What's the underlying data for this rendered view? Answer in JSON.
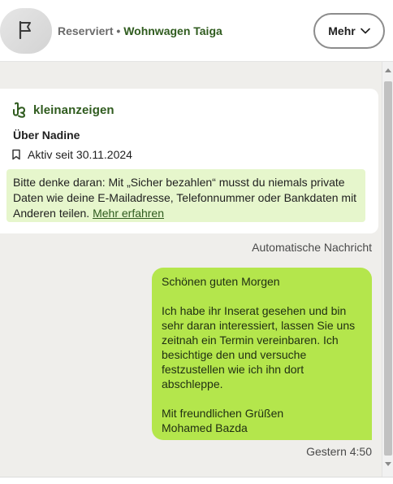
{
  "header": {
    "status": "Reserviert",
    "separator": "•",
    "listing_title": "Wohnwagen Taiga",
    "more_label": "Mehr"
  },
  "info_card": {
    "brand": "kleinanzeigen",
    "about_title": "Über Nadine",
    "active_since": "Aktiv seit 30.11.2024",
    "notice_text": "Bitte denke daran: Mit „Sicher bezahlen“ musst du niemals private Daten wie deine E-Mailadresse, Telefonnummer oder Bankdaten mit Anderen teilen.",
    "notice_link": "Mehr erfahren"
  },
  "messages": [
    {
      "label": "Automatische Nachricht",
      "greeting": "Schönen guten Morgen",
      "body": "Ich habe ihr Inserat gesehen und bin sehr daran interessiert, lassen Sie uns zeitnah ein Termin vereinbaren. Ich besichtige den und versuche festzustellen wie ich ihn dort abschleppe.",
      "closing": "Mit freundlichen Grüßen",
      "signature": "Mohamed Bazda",
      "time": "Gestern 4:50"
    }
  ],
  "colors": {
    "brand_green": "#2f5b1e",
    "bubble_green": "#b4e64c",
    "notice_bg": "#e6f6cc",
    "chat_bg": "#efeeeb"
  },
  "icons": {
    "avatar": "flag-icon",
    "more": "chevron-down-icon",
    "active": "bookmark-icon",
    "logo": "kleinanzeigen-logo-icon"
  }
}
